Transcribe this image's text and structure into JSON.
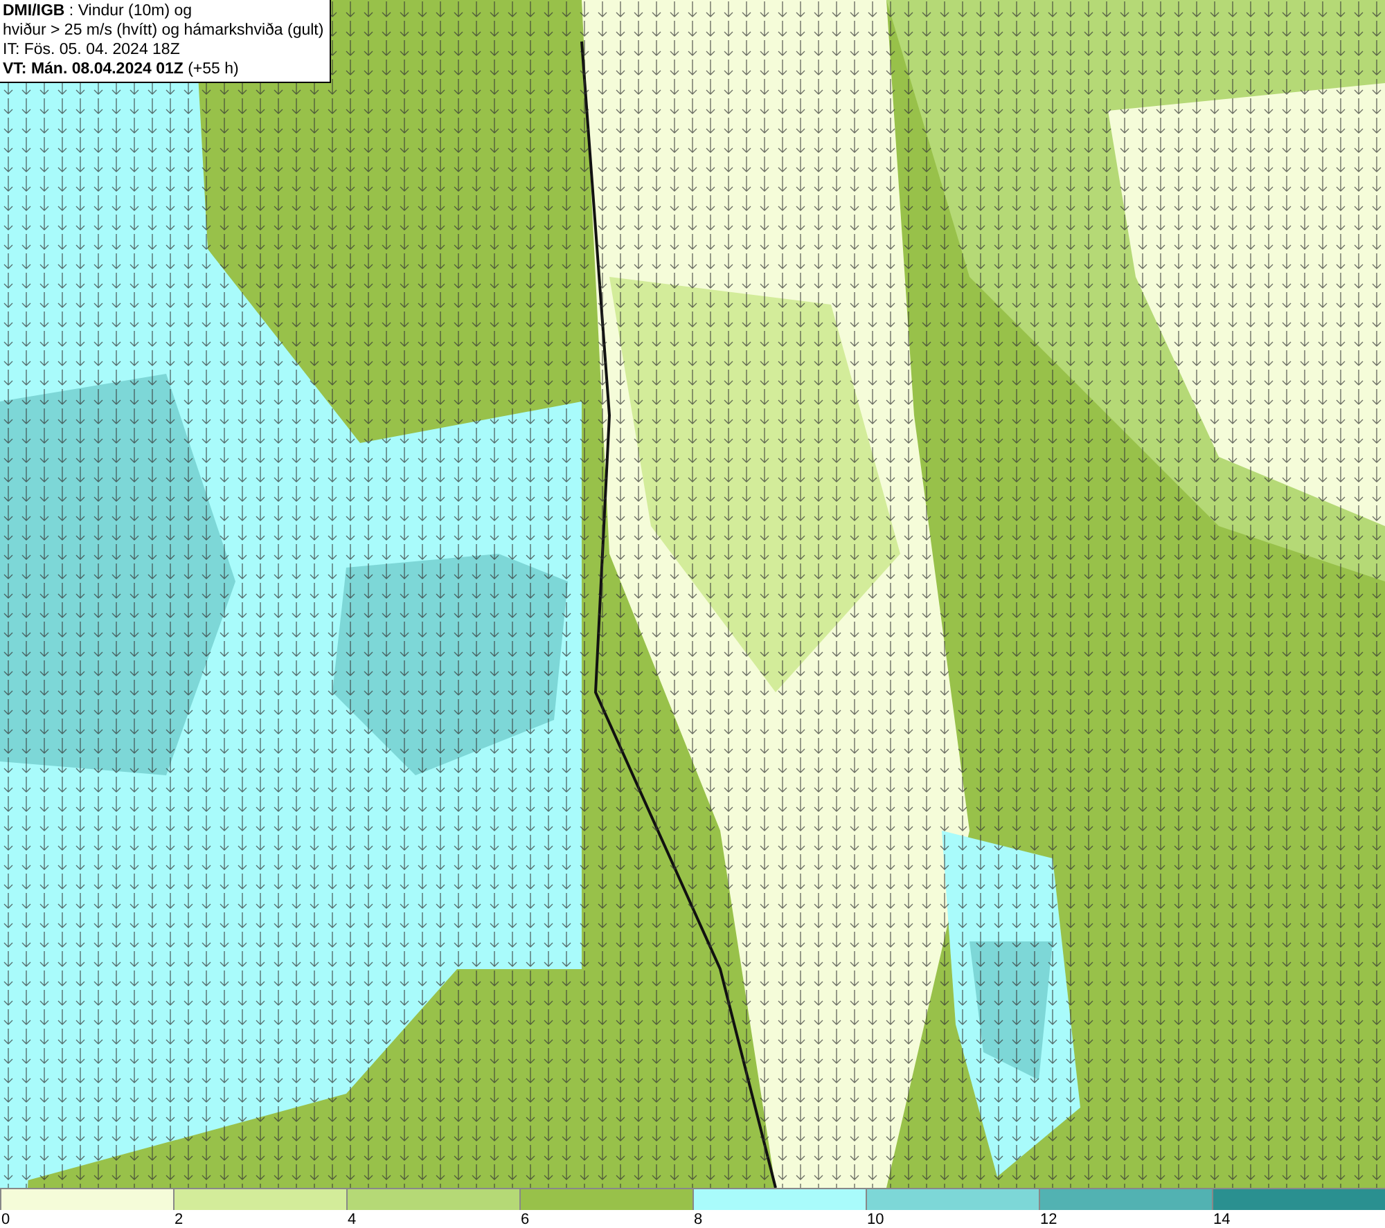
{
  "legend": {
    "lines": [
      "**DMI/IGB** : Vindur (10m) og",
      "hviður > 25 m/s (hvítt) og hámarkshviða (gult)",
      "IT: Fös. 05. 04. 2024 18Z",
      "**VT: Mán. 08.04.2024 01Z** (+55 h)"
    ]
  },
  "colorbar": {
    "segments": [
      {
        "label": "0",
        "color": "#f5fcd9"
      },
      {
        "label": "2",
        "color": "#d3ec9a"
      },
      {
        "label": "4",
        "color": "#b5d976"
      },
      {
        "label": "6",
        "color": "#98c14a"
      },
      {
        "label": "8",
        "color": "#a9fbfb"
      },
      {
        "label": "10",
        "color": "#7dd7d7"
      },
      {
        "label": "12",
        "color": "#52b2b2"
      },
      {
        "label": "14",
        "color": "#2a9090"
      }
    ]
  }
}
